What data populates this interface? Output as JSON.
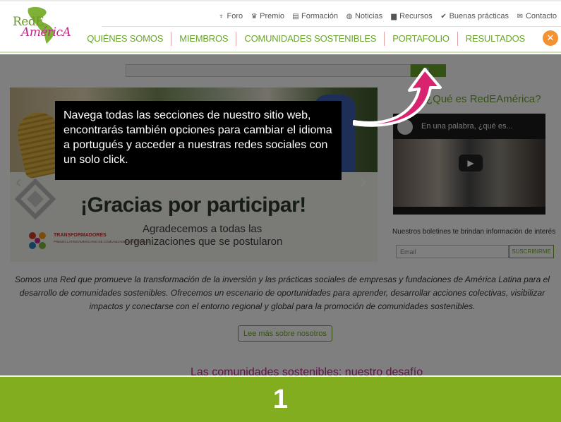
{
  "logo": {
    "line1": "RedE",
    "line2": "AméricA"
  },
  "util_nav": [
    {
      "icon": "torch-icon",
      "glyph": "♆",
      "label": "Foro"
    },
    {
      "icon": "trophy-icon",
      "glyph": "♛",
      "label": "Premio"
    },
    {
      "icon": "book-icon",
      "glyph": "▤",
      "label": "Formación"
    },
    {
      "icon": "globe-icon",
      "glyph": "◍",
      "label": "Noticias"
    },
    {
      "icon": "folder-icon",
      "glyph": "▆",
      "label": "Recursos"
    },
    {
      "icon": "check-icon",
      "glyph": "✔",
      "label": "Buenas prácticas"
    },
    {
      "icon": "envelope-icon",
      "glyph": "✉",
      "label": "Contacto"
    }
  ],
  "main_nav": [
    {
      "label": "QUIÉNES SOMOS"
    },
    {
      "label": "MIEMBROS"
    },
    {
      "label": "COMUNIDADES SOSTENIBLES"
    },
    {
      "label": "PORTAFOLIO"
    },
    {
      "label": "RESULTADOS"
    }
  ],
  "tools_glyph": "✕",
  "search": {
    "button_glyph": "🔍"
  },
  "slider": {
    "title": "¡Gracias por participar!",
    "subtitle1": "Agradecemos a todas las",
    "subtitle2": "organizaciones que se postularon",
    "logo_text": "TRANSFORMADORES",
    "logo_sub": "PREMIO LATINOAMERICANO DE COMUNIDADES SOSTENIBLES",
    "prev_glyph": "‹",
    "next_glyph": "›"
  },
  "sidebar": {
    "title": "¿Qué es RedEAmérica?",
    "video_title": "En una palabra, ¿qué es...",
    "play_glyph": "▶",
    "newsletter_text": "Nuestros boletines te brindan información de interés",
    "email_placeholder": "Email",
    "subscribe_label": "SUSCRIBIRME"
  },
  "intro_text": "Somos una Red que promueve la transformación de la inversión y las prácticas sociales de empresas y fundaciones de América Latina para el desarrollo de comunidades sostenibles. Ofrecemos un escenario de oportunidades para aprender, desarrollar acciones colectivas, visibilizar impactos y conectarse con el entorno regional y global para la promoción de comunidades sostenibles.",
  "more_label": "Lee más sobre nosotros",
  "section_heading": "Las comunidades sostenibles: nuestro desafío",
  "tooltip": "Navega todas las secciones de nuestro sitio web, encontrarás también opciones para cambiar el idioma a portugués y acceder a nuestras redes sociales con un solo click.",
  "step_number": "1",
  "colors": {
    "brand_green": "#6aa52b",
    "brand_magenta": "#c3268a",
    "arrow": "#d8246f",
    "step_bar": "#81ad1f"
  }
}
